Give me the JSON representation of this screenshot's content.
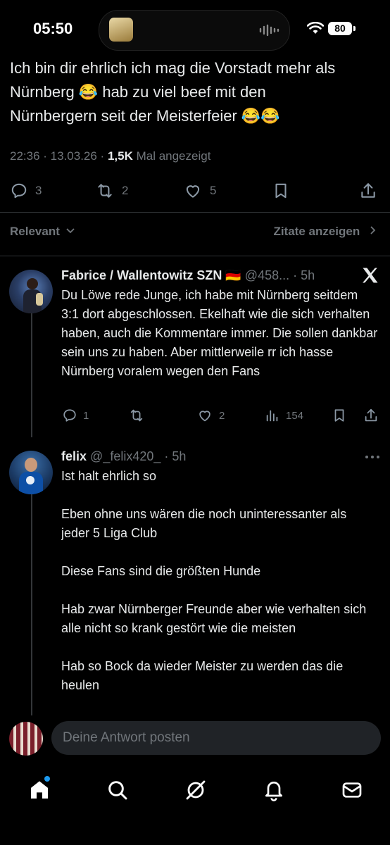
{
  "status_bar": {
    "time": "05:50",
    "battery": "80"
  },
  "tweet": {
    "text_line1": "Ich bin dir ehrlich ich mag die Vorstadt mehr als",
    "text_line2": "Nürnberg 😂 hab zu viel beef mit den",
    "text_line3": "Nürnbergern  seit der Meisterfeier 😂😂",
    "timestamp": "22:36 · 13.03.26 · ",
    "views_count": "1,5K",
    "views_label": " Mal angezeigt",
    "replies": "3",
    "reposts": "2",
    "likes": "5"
  },
  "sort": {
    "label": "Relevant",
    "quotes_label": "Zitate anzeigen"
  },
  "replies": [
    {
      "name": "Fabrice / Wallentowitz SZN 🇩🇪",
      "handle": "@458...",
      "time": "· 5h",
      "text": "Du Löwe rede Junge, ich habe mit Nürnberg seitdem 3:1 dort abgeschlossen. Ekelhaft wie die sich verhalten haben, auch die Kommentare immer. Die sollen dankbar sein uns zu haben. Aber mittlerweile rr ich hasse Nürnberg voralem wegen den Fans",
      "replies": "1",
      "reposts": "",
      "likes": "2",
      "views": "154"
    },
    {
      "name": "felix",
      "handle": "@_felix420_",
      "time": "· 5h",
      "text": "Ist halt ehrlich so\n\nEben ohne uns wären die noch uninteressanter als jeder 5 Liga Club\n\nDiese Fans sind die größten Hunde\n\nHab zwar Nürnberger Freunde aber wie verhalten sich alle nicht so krank gestört  wie die meisten\n\nHab so Bock da wieder Meister zu werden das die heulen"
    }
  ],
  "composer": {
    "placeholder": "Deine Antwort posten"
  },
  "colors": {
    "accent": "#1d9bf0",
    "muted": "#71767b",
    "text": "#e7e9ea",
    "background": "#000000"
  }
}
